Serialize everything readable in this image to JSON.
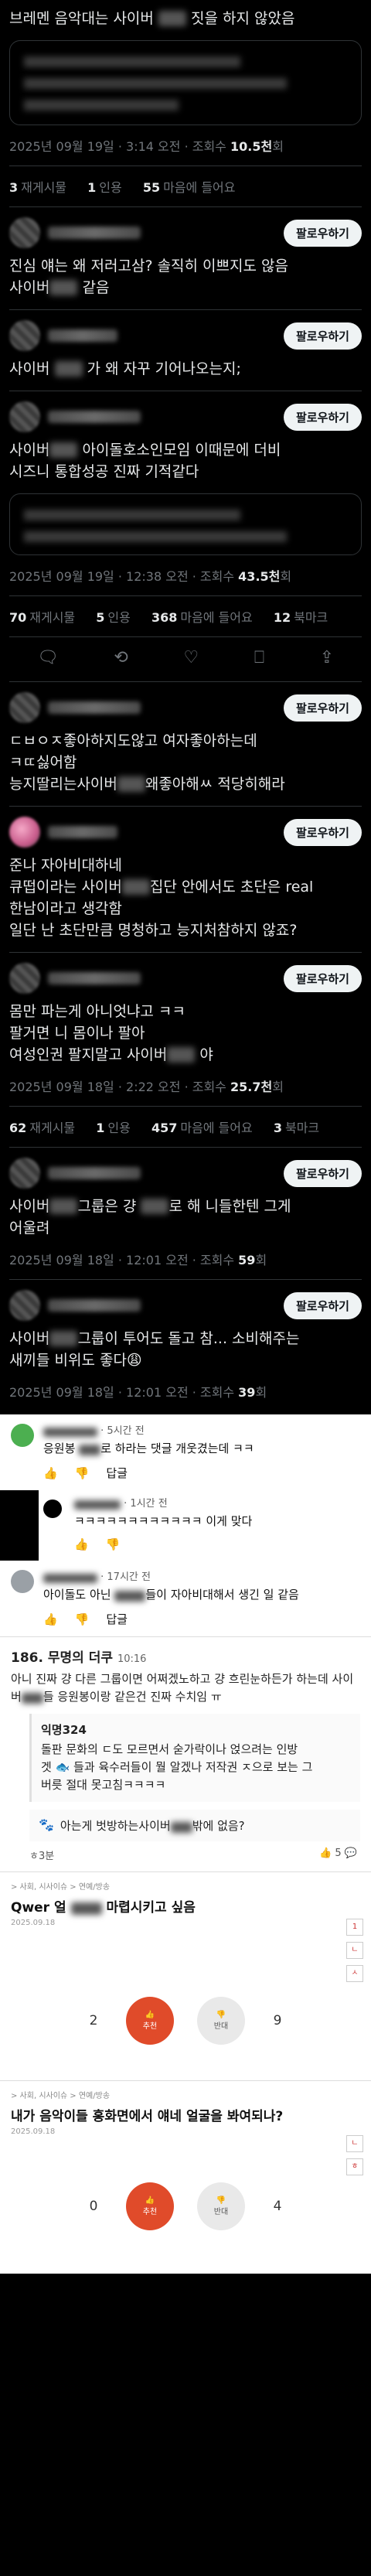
{
  "tweet1": {
    "text": "브레멘 음악대는 사이버",
    "text_end": "짓을 하지 않았음",
    "time": "2025년 09월 19일 · 3:14 오전 · 조회수 ",
    "views": "10.5천",
    "views_unit": "회",
    "retweets": "3",
    "retweets_label": "재게시물",
    "quotes": "1",
    "quotes_label": "인용",
    "likes": "55",
    "likes_label": "마음에 들어요"
  },
  "follow_label": "팔로우하기",
  "reply1": {
    "text": "진심 얘는 왜 저러고삼? 솔직히 이쁘지도 않음\n사이버",
    "text_end": "같음"
  },
  "reply2": {
    "text": "사이버",
    "text_end": "가 왜 자꾸 기어나오는지;"
  },
  "tweet2": {
    "text_a": "사이버",
    "text_b": "아이돌호소인모임 이때문에 더비\n시즈니 통합성공 진짜 기적같다",
    "time": "2025년 09월 19일 · 12:38 오전 · 조회수 ",
    "views": "43.5천",
    "views_unit": "회",
    "retweets": "70",
    "retweets_label": "재게시물",
    "quotes": "5",
    "quotes_label": "인용",
    "likes": "368",
    "likes_label": "마음에 들어요",
    "bookmarks": "12",
    "bookmarks_label": "북마크"
  },
  "reply3": {
    "text": "ㄷㅂㅇㅈ좋아하지도않고 여자좋아하는데\nㅋㄸ싫어함\n능지딸리는사이버",
    "text_end": "왜좋아해ㅆ 적당히해라"
  },
  "reply4": {
    "text": "준나 자아비대하네\n큐떱이라는 사이버",
    "text_mid": "집단 안에서도 초단은 real\n한남이라고 생각함\n일단 난 초단만큼 명청하고 능지처참하지 않죠?"
  },
  "tweet3": {
    "text": "몸만 파는게 아니엇냐고 ㅋㅋ\n팔거면 니 몸이나 팔아\n여성인권 팔지말고 사이버",
    "text_end": "야",
    "time": "2025년 09월 18일 · 2:22 오전 · 조회수 ",
    "views": "25.7천",
    "views_unit": "회",
    "retweets": "62",
    "retweets_label": "재게시물",
    "quotes": "1",
    "quotes_label": "인용",
    "likes": "457",
    "likes_label": "마음에 들어요",
    "bookmarks": "3",
    "bookmarks_label": "북마크"
  },
  "tweet4": {
    "text": "사이버",
    "text_end": "그룹은 걍",
    "text_tail": "로 해 니들한텐 그게\n어울려",
    "time": "2025년 09월 18일 · 12:01 오전 · 조회수 ",
    "views": "59",
    "views_unit": "회"
  },
  "tweet5": {
    "text": "사이버",
    "text_end": "그룹이 투어도 돌고 참... 소비해주는\n새끼들 비위도 좋다😩",
    "time": "2025년 09월 18일 · 12:01 오전 · 조회수 ",
    "views": "39",
    "views_unit": "회"
  },
  "yt1": {
    "meta": "· 5시간 전",
    "text": "응원봉",
    "text_end": "로 하라는 댓글 개웃겼는데 ㅋㅋ",
    "likes": "",
    "reply_label": "답글"
  },
  "yt1r": {
    "meta": "· 1시간 전",
    "text": "ㅋㅋㅋㅋㅋㅋㅋㅋㅋㅋㅋㅋ 이게 맞다"
  },
  "yt2": {
    "meta": "· 17시간 전",
    "text": "아이돌도 아닌",
    "text_end": "들이 자아비대해서 생긴 일 같음",
    "reply_label": "답글"
  },
  "board": {
    "title": "186. 무명의 더쿠",
    "stamp": "10:16",
    "text": "아니 진짜 걍 다른 그룹이면 어쩌겠노하고 걍 흐린눈하든가 하는데 사이버",
    "text_end": "들 응원봉이랑 같은건 진짜 수치임 ㅠ",
    "sub_nick": "익명324",
    "sub_text": "돌판 문화의 ㄷ도 모르면서 숟가락이나 얹으려는 인방\n겟 🐟 들과 육수러들이 뭘 알겠나 저작권 ㅈ으로 보는 그\n버릇 절대 못고침ㅋㅋㅋㅋ",
    "sub2_text": "아는게 벗방하는사이버",
    "sub2_end": "밖에 없음?",
    "foot_left": "ㅎ3분",
    "foot_right": "5"
  },
  "post1": {
    "crumb": "> 사회, 시사이슈 > 연예/방송",
    "title": "Qwer 얼",
    "title_end": "마렵시키고 싶음",
    "date": "2025.09.18",
    "up": "2",
    "down": "9",
    "up_label": "추천",
    "down_label": "반대",
    "tags": [
      "1",
      "ㄴ",
      "ㅅ"
    ]
  },
  "post2": {
    "crumb": "> 사회, 시사이슈 > 연예/방송",
    "title": "내가 음악이들 홍화면에서 얘네 얼굴을 봐여되나?",
    "date": "2025.09.18",
    "up": "0",
    "down": "4",
    "up_label": "추천",
    "down_label": "반대",
    "tags": [
      "ㄴ",
      "ㅎ"
    ]
  },
  "colors": {
    "bg": "#000000",
    "text": "#e7e9ea",
    "muted": "#71767b",
    "border": "#2f3336",
    "upvote": "#e04b2a"
  }
}
